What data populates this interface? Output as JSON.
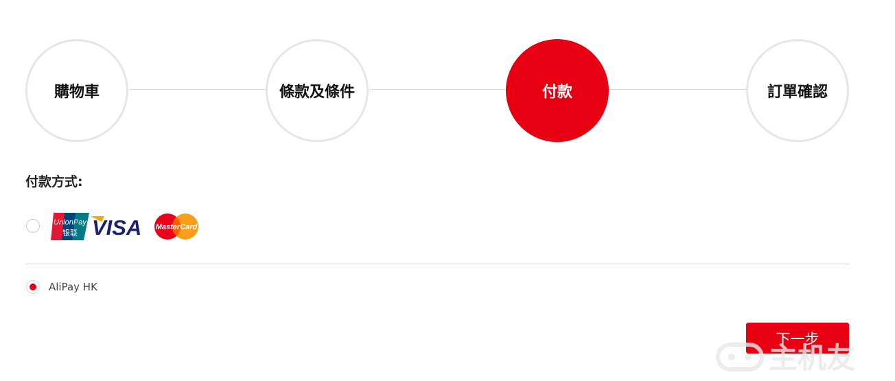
{
  "stepper": {
    "steps": [
      {
        "label": "購物車"
      },
      {
        "label": "條款及條件"
      },
      {
        "label": "付款"
      },
      {
        "label": "訂單確認"
      }
    ],
    "active_index": 2
  },
  "payment": {
    "section_title": "付款方式:",
    "options": [
      {
        "logos": {
          "unionpay_en": "UnionPay",
          "unionpay_cn": "银联",
          "visa": "VISA",
          "mastercard": "MasterCard"
        },
        "selected": false
      },
      {
        "label": "AliPay HK",
        "selected": true
      }
    ]
  },
  "actions": {
    "next_label": "下一步"
  },
  "watermark": {
    "text": "主机友"
  },
  "colors": {
    "accent": "#e60012",
    "step_border": "#e6e6e6",
    "divider": "#cfcfcf"
  }
}
